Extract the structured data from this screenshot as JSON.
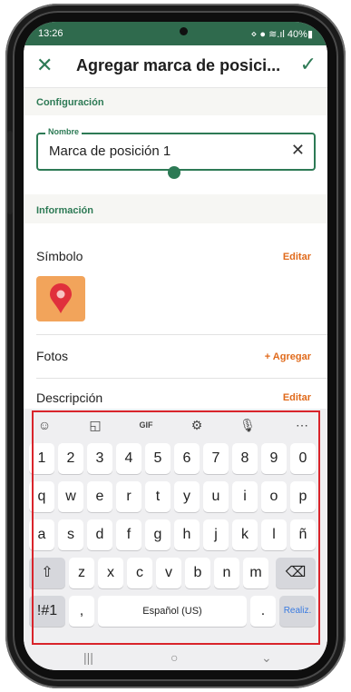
{
  "status": {
    "time": "13:26",
    "right": "⋄ ● ≋.ıl 40%▮"
  },
  "appbar": {
    "title": "Agregar marca de posici...",
    "close_icon": "close-icon",
    "confirm_icon": "check-icon"
  },
  "config": {
    "section_title": "Configuración",
    "name_label": "Nombre",
    "name_value": "Marca de posición 1"
  },
  "info": {
    "section_title": "Información",
    "symbol_label": "Símbolo",
    "symbol_action": "Editar",
    "photos_label": "Fotos",
    "photos_action": "+ Agregar",
    "desc_label": "Descripción",
    "desc_action": "Editar"
  },
  "keyboard": {
    "toolbar": [
      "emoji-icon",
      "sticker-icon",
      "gif-icon",
      "settings-icon",
      "mic-icon",
      "more-icon"
    ],
    "row1": [
      "1",
      "2",
      "3",
      "4",
      "5",
      "6",
      "7",
      "8",
      "9",
      "0"
    ],
    "row2": [
      "q",
      "w",
      "e",
      "r",
      "t",
      "y",
      "u",
      "i",
      "o",
      "p"
    ],
    "row3": [
      "a",
      "s",
      "d",
      "f",
      "g",
      "h",
      "j",
      "k",
      "l",
      "ñ"
    ],
    "row4": [
      "z",
      "x",
      "c",
      "v",
      "b",
      "n",
      "m"
    ],
    "symbols": "!#1",
    "comma": ",",
    "space": "Español (US)",
    "period": ".",
    "done": "Realiz."
  },
  "colors": {
    "accent": "#2d7a55",
    "action": "#e06a1b",
    "highlight": "#d9242b"
  }
}
